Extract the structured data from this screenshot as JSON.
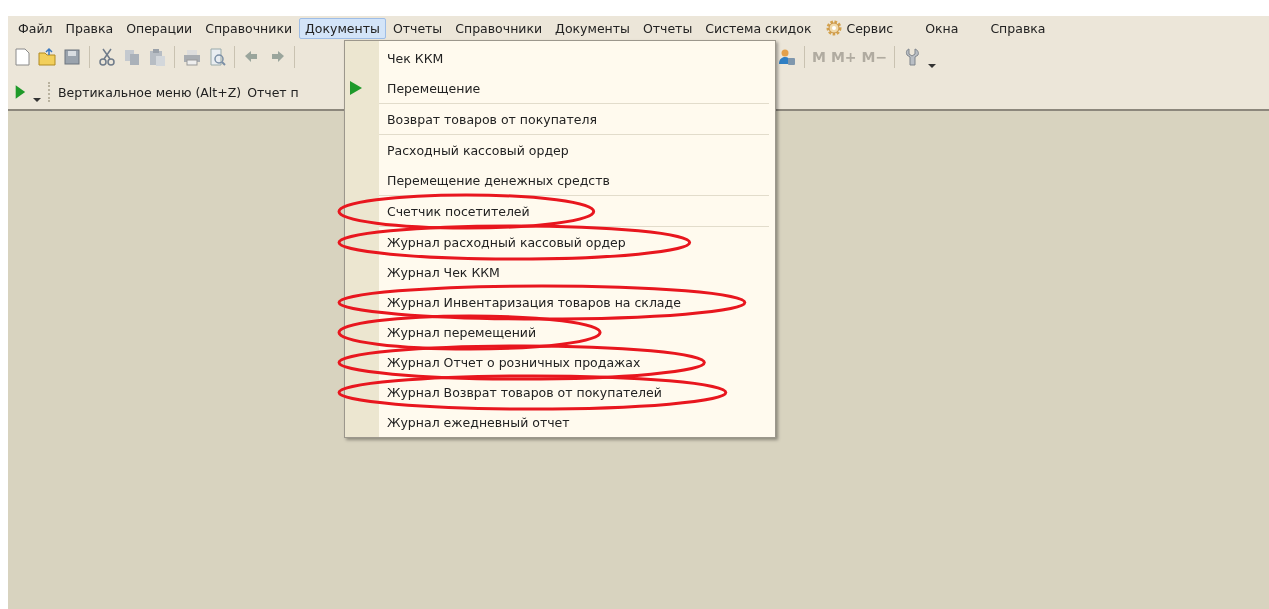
{
  "menu_bar": [
    {
      "label": "Файл",
      "selected": false
    },
    {
      "label": "Правка",
      "selected": false
    },
    {
      "label": "Операции",
      "selected": false
    },
    {
      "label": "Справочники",
      "selected": false
    },
    {
      "label": "Документы",
      "selected": true
    },
    {
      "label": "Отчеты",
      "selected": false
    },
    {
      "label": "Справочники",
      "selected": false
    },
    {
      "label": "Документы",
      "selected": false
    },
    {
      "label": "Отчеты",
      "selected": false
    },
    {
      "label": "Система скидок",
      "selected": false
    },
    {
      "label": "Сервис",
      "selected": false,
      "kind": "gear"
    },
    {
      "label": "Окна",
      "selected": false
    },
    {
      "label": "Справка",
      "selected": false
    }
  ],
  "toolbar": {
    "memory_buttons": [
      "M",
      "M+",
      "M−"
    ]
  },
  "quick_bar": {
    "items": [
      "Вертикальное меню (Alt+Z)",
      "Отчет п"
    ]
  },
  "dropdown": {
    "groups": [
      [
        {
          "label": "Чек ККМ",
          "kind": "plain",
          "highlighted": false
        },
        {
          "label": "Перемещение",
          "kind": "run",
          "highlighted": false
        }
      ],
      [
        {
          "label": "Возврат товаров от покупателя",
          "kind": "plain",
          "highlighted": false
        }
      ],
      [
        {
          "label": "Расходный кассовый ордер",
          "kind": "plain",
          "highlighted": false
        },
        {
          "label": "Перемещение денежных средств",
          "kind": "plain",
          "highlighted": false
        }
      ],
      [
        {
          "label": "Счетчик посетителей",
          "kind": "plain",
          "highlighted": true
        }
      ],
      [
        {
          "label": "Журнал расходный кассовый ордер",
          "kind": "plain",
          "highlighted": true
        },
        {
          "label": "Журнал Чек ККМ",
          "kind": "plain",
          "highlighted": false
        },
        {
          "label": "Журнал Инвентаризация товаров на складе",
          "kind": "plain",
          "highlighted": true
        },
        {
          "label": "Журнал перемещений",
          "kind": "plain",
          "highlighted": true
        },
        {
          "label": "Журнал Отчет о розничных продажах",
          "kind": "plain",
          "highlighted": true
        },
        {
          "label": "Журнал Возврат товаров от покупателей",
          "kind": "plain",
          "highlighted": true
        },
        {
          "label": "Журнал ежедневный отчет",
          "kind": "plain",
          "highlighted": false
        }
      ]
    ]
  }
}
